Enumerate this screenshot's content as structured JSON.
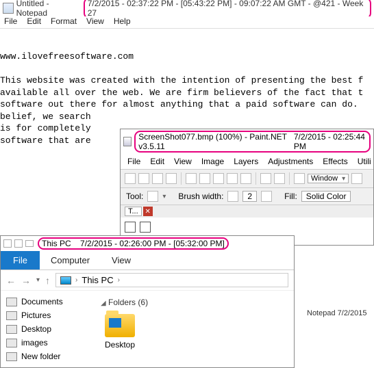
{
  "notepad": {
    "title_prefix": "Untitled - Notepad",
    "title_clock": "7/2/2015 - 02:37:22 PM - [05:43:22 PM] - 09:07:22 AM GMT - @421 - Week 27",
    "menu": [
      "File",
      "Edit",
      "Format",
      "View",
      "Help"
    ],
    "body": "www.ilovefreesoftware.com\n\nThis website was created with the intention of presenting the best f\navailable all over the web. We are firm believers of the fact that t\nsoftware out there for almost anything that a paid software can do. \nbelief, we search \nis for completely \nsoftware that are "
  },
  "paint": {
    "title_left": "ScreenShot077.bmp (100%) - Paint.NET v3.5.11",
    "title_right": "7/2/2015 - 02:25:44 PM",
    "menu": [
      "File",
      "Edit",
      "View",
      "Image",
      "Layers",
      "Adjustments",
      "Effects",
      "Utili"
    ],
    "tool_label": "Tool:",
    "brush_label": "Brush width:",
    "brush_value": "2",
    "fill_label": "Fill:",
    "fill_value": "Solid Color",
    "window_label": "Window",
    "tab_label": "T..."
  },
  "explorer": {
    "title_left": "This PC",
    "title_clock": "7/2/2015 - 02:26:00 PM - [05:32:00 PM]",
    "ribbon_file": "File",
    "ribbon_tabs": [
      "Computer",
      "View"
    ],
    "breadcrumb": "This PC",
    "side": [
      "Documents",
      "Pictures",
      "Desktop",
      "images",
      "New folder"
    ],
    "folders_head": "Folders (6)",
    "folder1": "Desktop",
    "right_status": "Notepad   7/2/2015"
  }
}
